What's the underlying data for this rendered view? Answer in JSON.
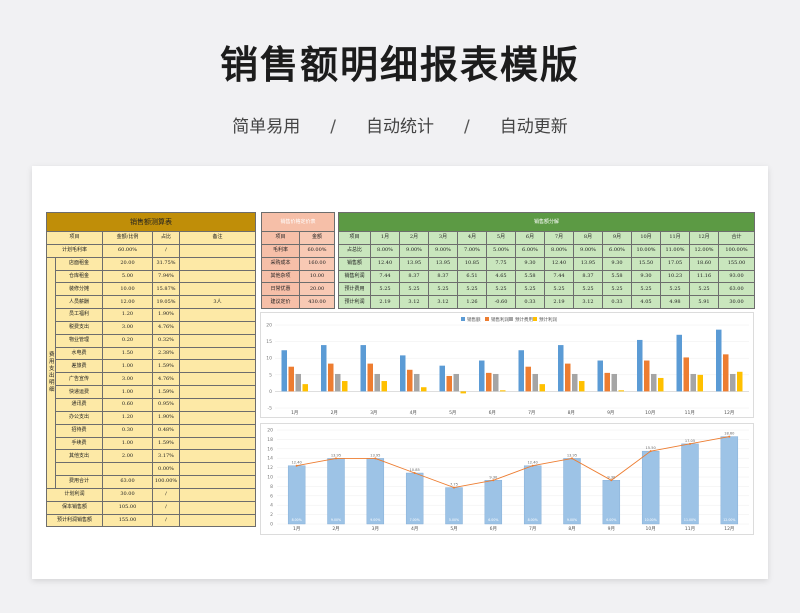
{
  "page": {
    "title": "销售额明细报表模版",
    "subtitle": [
      "简单易用",
      "自动统计",
      "自动更新"
    ],
    "separator": "/"
  },
  "left_table": {
    "title": "销售额测算表",
    "headers": [
      "项目",
      "金额/比例",
      "占比",
      "备注"
    ],
    "gross_row": [
      "计划毛利率",
      "60.00%",
      "/",
      ""
    ],
    "group_label": "费用支出明细",
    "cost_rows": [
      [
        "店面租金",
        "20.00",
        "31.75%",
        ""
      ],
      [
        "仓库租金",
        "5.00",
        "7.94%",
        ""
      ],
      [
        "装修分摊",
        "10.00",
        "15.87%",
        ""
      ],
      [
        "人员薪酬",
        "12.00",
        "19.05%",
        "3人"
      ],
      [
        "员工福利",
        "1.20",
        "1.90%",
        ""
      ],
      [
        "税费支出",
        "3.00",
        "4.76%",
        ""
      ],
      [
        "物业管理",
        "0.20",
        "0.32%",
        ""
      ],
      [
        "水电费",
        "1.50",
        "2.38%",
        ""
      ],
      [
        "差旅费",
        "1.00",
        "1.59%",
        ""
      ],
      [
        "广告宣传",
        "3.00",
        "4.76%",
        ""
      ],
      [
        "快递运费",
        "1.00",
        "1.59%",
        ""
      ],
      [
        "通讯费",
        "0.60",
        "0.95%",
        ""
      ],
      [
        "办公支出",
        "1.20",
        "1.90%",
        ""
      ],
      [
        "招待费",
        "0.30",
        "0.48%",
        ""
      ],
      [
        "手续费",
        "1.00",
        "1.59%",
        ""
      ],
      [
        "其他支出",
        "2.00",
        "3.17%",
        ""
      ],
      [
        "",
        "",
        "0.00%",
        ""
      ],
      [
        "费用合计",
        "63.00",
        "100.00%",
        ""
      ]
    ],
    "footer_rows": [
      [
        "计划利润",
        "30.00",
        "/",
        ""
      ],
      [
        "保本销售额",
        "105.00",
        "/",
        ""
      ],
      [
        "预计利润销售额",
        "155.00",
        "/",
        ""
      ]
    ]
  },
  "cost_table": {
    "title": "销售价格定价表",
    "headers": [
      "项目",
      "金额"
    ],
    "rows": [
      [
        "毛利率",
        "60.00%"
      ],
      [
        "采购成本",
        "160.00"
      ],
      [
        "其他杂项",
        "10.00"
      ],
      [
        "日常优惠",
        "20.00"
      ],
      [
        "建议定价",
        "430.00"
      ]
    ]
  },
  "month_table": {
    "title": "销售额分解",
    "headers": [
      "项目",
      "1月",
      "2月",
      "3月",
      "4月",
      "5月",
      "6月",
      "7月",
      "8月",
      "9月",
      "10月",
      "11月",
      "12月",
      "合计"
    ],
    "rows": [
      [
        "占总比",
        "8.00%",
        "9.00%",
        "9.00%",
        "7.00%",
        "5.00%",
        "6.00%",
        "8.00%",
        "9.00%",
        "6.00%",
        "10.00%",
        "11.00%",
        "12.00%",
        "100.00%"
      ],
      [
        "销售额",
        "12.40",
        "13.95",
        "13.95",
        "10.85",
        "7.75",
        "9.30",
        "12.40",
        "13.95",
        "9.30",
        "15.50",
        "17.05",
        "18.60",
        "155.00"
      ],
      [
        "销售利润",
        "7.44",
        "8.37",
        "8.37",
        "6.51",
        "4.65",
        "5.58",
        "7.44",
        "8.37",
        "5.58",
        "9.30",
        "10.23",
        "11.16",
        "93.00"
      ],
      [
        "预计费用",
        "5.25",
        "5.25",
        "5.25",
        "5.25",
        "5.25",
        "5.25",
        "5.25",
        "5.25",
        "5.25",
        "5.25",
        "5.25",
        "5.25",
        "63.00"
      ],
      [
        "预计利润",
        "2.19",
        "3.12",
        "3.12",
        "1.26",
        "-0.60",
        "0.33",
        "2.19",
        "3.12",
        "0.33",
        "4.05",
        "4.98",
        "5.91",
        "30.00"
      ]
    ]
  },
  "chart_data": [
    {
      "type": "bar",
      "categories": [
        "1月",
        "2月",
        "3月",
        "4月",
        "5月",
        "6月",
        "7月",
        "8月",
        "9月",
        "10月",
        "11月",
        "12月"
      ],
      "series": [
        {
          "name": "销售额",
          "values": [
            12.4,
            13.95,
            13.95,
            10.85,
            7.75,
            9.3,
            12.4,
            13.95,
            9.3,
            15.5,
            17.05,
            18.6
          ],
          "color": "#5b9bd5"
        },
        {
          "name": "销售利润",
          "values": [
            7.44,
            8.37,
            8.37,
            6.51,
            4.65,
            5.58,
            7.44,
            8.37,
            5.58,
            9.3,
            10.23,
            11.16
          ],
          "color": "#ed7d31"
        },
        {
          "name": "预计费用",
          "values": [
            5.25,
            5.25,
            5.25,
            5.25,
            5.25,
            5.25,
            5.25,
            5.25,
            5.25,
            5.25,
            5.25,
            5.25
          ],
          "color": "#a5a5a5"
        },
        {
          "name": "预计利润",
          "values": [
            2.19,
            3.12,
            3.12,
            1.26,
            -0.6,
            0.33,
            2.19,
            3.12,
            0.33,
            4.05,
            4.98,
            5.91
          ],
          "color": "#ffc000"
        }
      ],
      "yticks": [
        "20",
        "15",
        "10",
        "5",
        "0",
        "-5"
      ],
      "ylim": [
        -5,
        20
      ],
      "legend": "top-center"
    },
    {
      "type": "bar",
      "categories": [
        "1月",
        "2月",
        "3月",
        "4月",
        "5月",
        "6月",
        "7月",
        "8月",
        "9月",
        "10月",
        "11月",
        "12月"
      ],
      "values": [
        12.4,
        13.95,
        13.95,
        10.85,
        7.75,
        9.3,
        12.4,
        13.95,
        9.3,
        15.5,
        17.05,
        18.6
      ],
      "value_labels": [
        "12.40",
        "13.95",
        "13.95",
        "10.85",
        "7.75",
        "9.30",
        "12.40",
        "13.95",
        "9.30",
        "15.50",
        "17.05",
        "18.60"
      ],
      "bar_labels": [
        "8.00%",
        "9.00%",
        "9.00%",
        "7.00%",
        "5.00%",
        "6.00%",
        "8.00%",
        "9.00%",
        "6.00%",
        "10.00%",
        "11.00%",
        "12.00%"
      ],
      "yticks": [
        "20",
        "18",
        "16",
        "14",
        "12",
        "10",
        "8",
        "6",
        "4",
        "2",
        "0"
      ],
      "ylim": [
        0,
        20
      ],
      "bar_color": "#9dc3e6",
      "line_color": "#ed7d31"
    }
  ]
}
